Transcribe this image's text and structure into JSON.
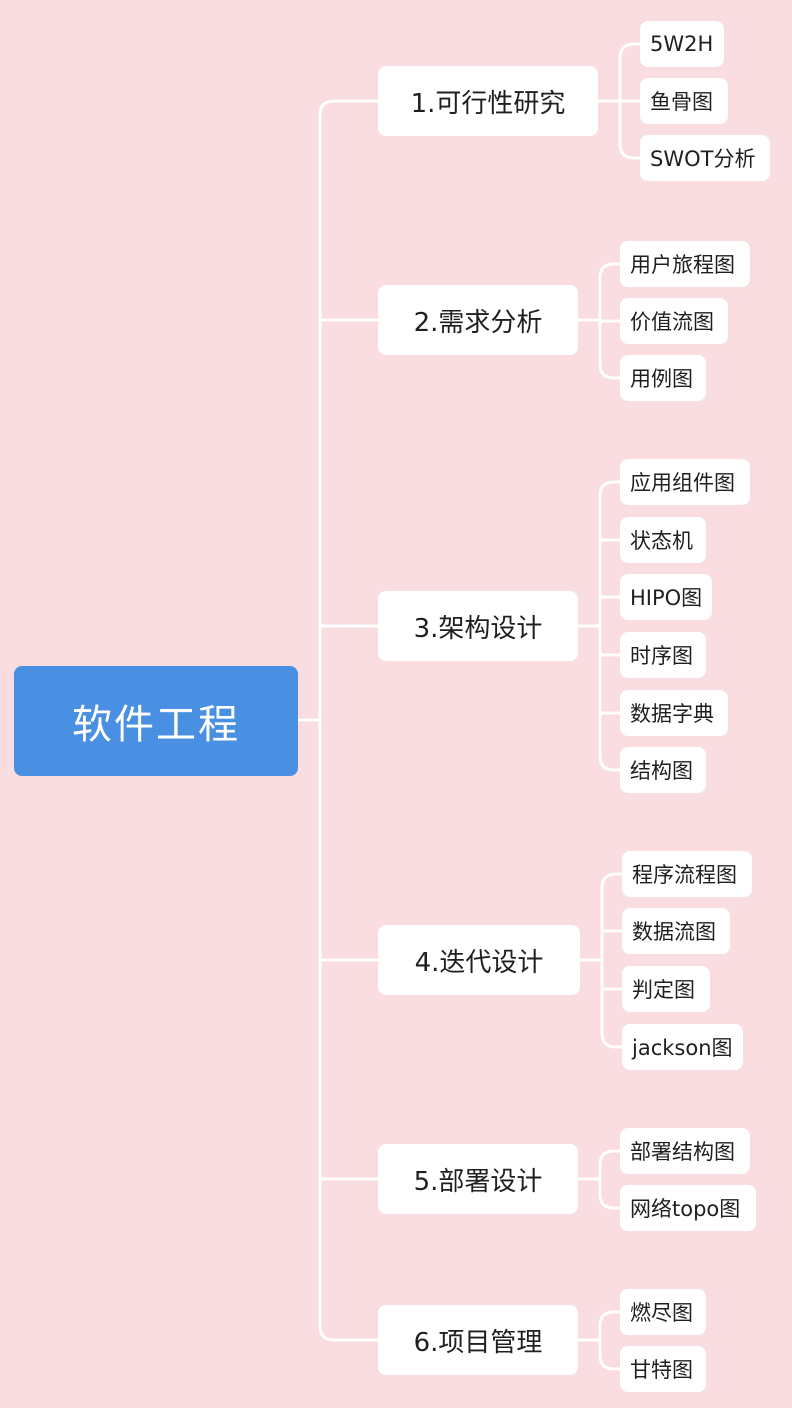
{
  "root": "软件工程",
  "colors": {
    "background": "#f9dde1",
    "root_fill": "#4a90e2",
    "node_fill": "#ffffff",
    "connector": "#ffffff"
  },
  "branches": [
    {
      "label": "1.可行性研究",
      "children": [
        "5W2H",
        "鱼骨图",
        "SWOT分析"
      ]
    },
    {
      "label": "2.需求分析",
      "children": [
        "用户旅程图",
        "价值流图",
        "用例图"
      ]
    },
    {
      "label": "3.架构设计",
      "children": [
        "应用组件图",
        "状态机",
        "HIPO图",
        "时序图",
        "数据字典",
        "结构图"
      ]
    },
    {
      "label": "4.迭代设计",
      "children": [
        "程序流程图",
        "数据流图",
        "判定图",
        "jackson图"
      ]
    },
    {
      "label": "5.部署设计",
      "children": [
        "部署结构图",
        "网络topo图"
      ]
    },
    {
      "label": "6.项目管理",
      "children": [
        "燃尽图",
        "甘特图"
      ]
    }
  ]
}
